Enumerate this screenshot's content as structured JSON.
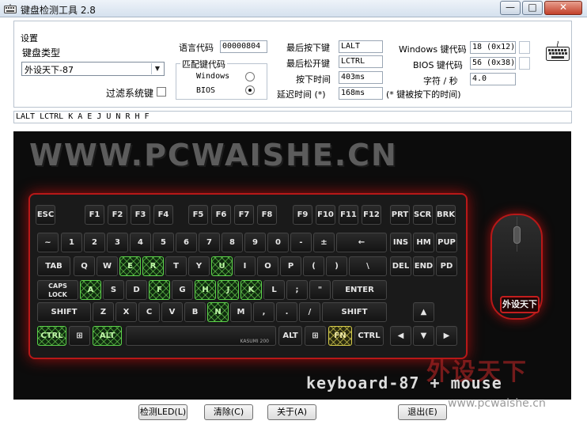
{
  "window": {
    "title": "键盘检测工具 2.8",
    "controls": {
      "minimize": "—",
      "maximize": "□",
      "close": "✕"
    }
  },
  "settings": {
    "group_label": "设置",
    "keyboard_type_label": "键盘类型",
    "keyboard_type_value": "外设天下-87",
    "filter_label": "过滤系统键",
    "language_code_label": "语言代码",
    "language_code_value": "00000804",
    "match_group_label": "匹配键代码",
    "windows_label": "Windows",
    "bios_label": "BIOS",
    "windows_selected": false,
    "bios_selected": true
  },
  "status": {
    "last_pressed_label": "最后按下键",
    "last_pressed_value": "LALT",
    "last_released_label": "最后松开键",
    "last_released_value": "LCTRL",
    "press_time_label": "按下时间",
    "press_time_value": "403ms",
    "delay_label": "延迟时间 (*)",
    "delay_value": "168ms",
    "delay_note": "(* 键被按下的时间)",
    "windows_code_label": "Windows 键代码",
    "windows_code_value": "18 (0x12)",
    "bios_code_label": "BIOS 键代码",
    "bios_code_value": "56 (0x38)",
    "cps_label": "字符 / 秒",
    "cps_value": "4.0"
  },
  "history": "LALT LCTRL K A E J U N R H F",
  "panel": {
    "banner": "WWW.PCWAISHE.CN",
    "model_text": "keyboard-87 + mouse",
    "mouse_logo": "外设天下",
    "watermark_cn": "外设天下",
    "watermark_url": "www.pcwaishe.cn",
    "spacebar_brand": "KASUMI 200"
  },
  "keyboard": {
    "active_color": "#5bd24a",
    "hold_color": "#d6cc4a",
    "rows": [
      [
        {
          "id": "esc",
          "label": "ESC"
        },
        {
          "id": "f1",
          "label": "F1"
        },
        {
          "id": "f2",
          "label": "F2"
        },
        {
          "id": "f3",
          "label": "F3"
        },
        {
          "id": "f4",
          "label": "F4"
        },
        {
          "id": "f5",
          "label": "F5"
        },
        {
          "id": "f6",
          "label": "F6"
        },
        {
          "id": "f7",
          "label": "F7"
        },
        {
          "id": "f8",
          "label": "F8"
        },
        {
          "id": "f9",
          "label": "F9"
        },
        {
          "id": "f10",
          "label": "F10"
        },
        {
          "id": "f11",
          "label": "F11"
        },
        {
          "id": "f12",
          "label": "F12"
        },
        {
          "id": "prt",
          "label": "PRT"
        },
        {
          "id": "scrl",
          "label": "SCRL"
        },
        {
          "id": "brk",
          "label": "BRK"
        }
      ],
      [
        {
          "id": "grave",
          "label": "~"
        },
        {
          "id": "1",
          "label": "1"
        },
        {
          "id": "2",
          "label": "2"
        },
        {
          "id": "3",
          "label": "3"
        },
        {
          "id": "4",
          "label": "4"
        },
        {
          "id": "5",
          "label": "5"
        },
        {
          "id": "6",
          "label": "6"
        },
        {
          "id": "7",
          "label": "7"
        },
        {
          "id": "8",
          "label": "8"
        },
        {
          "id": "9",
          "label": "9"
        },
        {
          "id": "0",
          "label": "0"
        },
        {
          "id": "minus",
          "label": "-"
        },
        {
          "id": "plus",
          "label": "±"
        },
        {
          "id": "back",
          "label": "←"
        },
        {
          "id": "ins",
          "label": "INS"
        },
        {
          "id": "hm",
          "label": "HM"
        },
        {
          "id": "pup",
          "label": "PUP"
        }
      ],
      [
        {
          "id": "tab",
          "label": "TAB"
        },
        {
          "id": "q",
          "label": "Q"
        },
        {
          "id": "w",
          "label": "W"
        },
        {
          "id": "e",
          "label": "E",
          "state": "on"
        },
        {
          "id": "r",
          "label": "R",
          "state": "on"
        },
        {
          "id": "t",
          "label": "T"
        },
        {
          "id": "y",
          "label": "Y"
        },
        {
          "id": "u",
          "label": "U",
          "state": "on"
        },
        {
          "id": "i",
          "label": "I"
        },
        {
          "id": "o",
          "label": "O"
        },
        {
          "id": "p",
          "label": "P"
        },
        {
          "id": "lbr",
          "label": "("
        },
        {
          "id": "rbr",
          "label": ")"
        },
        {
          "id": "bsl",
          "label": "\\"
        },
        {
          "id": "del",
          "label": "DEL"
        },
        {
          "id": "end",
          "label": "END"
        },
        {
          "id": "pd",
          "label": "PD"
        }
      ],
      [
        {
          "id": "caps",
          "label": "CAPS LOCK"
        },
        {
          "id": "a",
          "label": "A",
          "state": "on"
        },
        {
          "id": "s",
          "label": "S"
        },
        {
          "id": "d",
          "label": "D"
        },
        {
          "id": "f",
          "label": "F",
          "state": "on"
        },
        {
          "id": "g",
          "label": "G"
        },
        {
          "id": "h",
          "label": "H",
          "state": "on"
        },
        {
          "id": "j",
          "label": "J",
          "state": "on"
        },
        {
          "id": "k",
          "label": "K",
          "state": "on"
        },
        {
          "id": "l",
          "label": "L"
        },
        {
          "id": "semi",
          "label": ";"
        },
        {
          "id": "quote",
          "label": "\""
        },
        {
          "id": "enter",
          "label": "ENTER"
        }
      ],
      [
        {
          "id": "lshift",
          "label": "SHIFT"
        },
        {
          "id": "z",
          "label": "Z"
        },
        {
          "id": "x",
          "label": "X"
        },
        {
          "id": "c",
          "label": "C"
        },
        {
          "id": "v",
          "label": "V"
        },
        {
          "id": "b",
          "label": "B"
        },
        {
          "id": "n",
          "label": "N",
          "state": "on"
        },
        {
          "id": "m",
          "label": "M"
        },
        {
          "id": "comma",
          "label": ","
        },
        {
          "id": "dot",
          "label": "."
        },
        {
          "id": "slash",
          "label": "/"
        },
        {
          "id": "rshift",
          "label": "SHIFT"
        },
        {
          "id": "up",
          "label": "▲"
        }
      ],
      [
        {
          "id": "lctrl",
          "label": "CTRL",
          "state": "on"
        },
        {
          "id": "lwin",
          "label": "⊞"
        },
        {
          "id": "lalt",
          "label": "ALT",
          "state": "on"
        },
        {
          "id": "space",
          "label": ""
        },
        {
          "id": "ralt",
          "label": "ALT"
        },
        {
          "id": "rwin",
          "label": "⊞"
        },
        {
          "id": "fn",
          "label": "FN",
          "state": "hold"
        },
        {
          "id": "rctrl",
          "label": "CTRL"
        },
        {
          "id": "left",
          "label": "◀"
        },
        {
          "id": "down",
          "label": "▼"
        },
        {
          "id": "right",
          "label": "▶"
        }
      ]
    ]
  },
  "buttons": {
    "detect_led": "检测LED(L)",
    "clear": "清除(C)",
    "about": "关于(A)",
    "exit": "退出(E)"
  }
}
